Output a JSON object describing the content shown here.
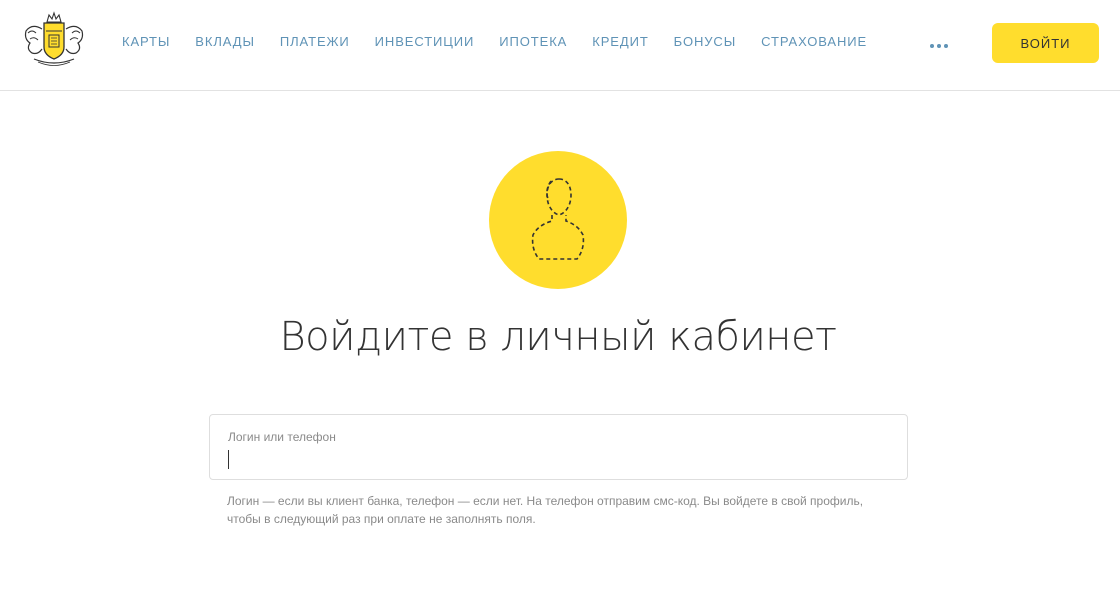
{
  "header": {
    "nav": [
      {
        "id": "cards",
        "label": "КАРТЫ"
      },
      {
        "id": "deposits",
        "label": "ВКЛАДЫ"
      },
      {
        "id": "payments",
        "label": "ПЛАТЕЖИ"
      },
      {
        "id": "investments",
        "label": "ИНВЕСТИЦИИ"
      },
      {
        "id": "mortgage",
        "label": "ИПОТЕКА"
      },
      {
        "id": "credit",
        "label": "КРЕДИТ"
      },
      {
        "id": "bonuses",
        "label": "БОНУСЫ"
      },
      {
        "id": "insurance",
        "label": "СТРАХОВАНИЕ"
      }
    ],
    "more_icon": "more-dots-icon",
    "login_label": "ВОЙТИ"
  },
  "main": {
    "avatar_icon": "user-silhouette-icon",
    "title": "Войдите в личный кабинет",
    "login_field": {
      "label": "Логин или телефон",
      "value": ""
    },
    "hint": "Логин — если вы клиент банка, телефон — если нет. На телефон отправим смс-код. Вы войдете в свой профиль, чтобы в следующий раз при оплате не заполнять поля."
  },
  "colors": {
    "accent_yellow": "#ffdd2d",
    "nav_text": "#5f93b6",
    "title_text": "#333333",
    "muted_text": "#8a8a8a",
    "border": "#dedede"
  }
}
